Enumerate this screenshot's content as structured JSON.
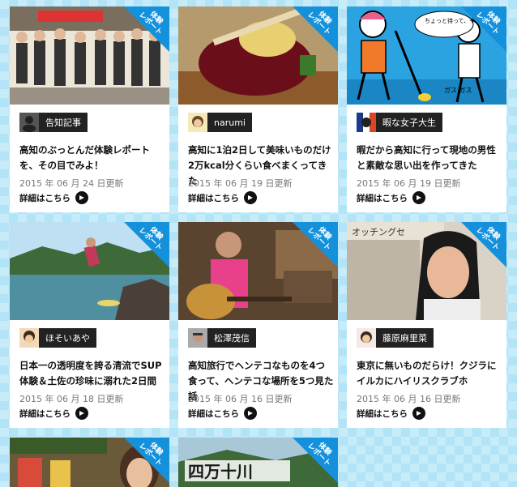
{
  "ribbon_text": "体験\nレポート",
  "more_label": "詳細はこちら",
  "cards": [
    {
      "author": "告知記事",
      "title": "高知のぶっとんだ体験レポートを、その目でみよ！",
      "date": "2015 年 06 月 24 日更新",
      "thumb_icon": "group-photo"
    },
    {
      "author": "narumi",
      "title": "高知に1泊2日して美味いものだけ2万kcal分くらい食べまくってきた",
      "date": "2015 年 06 月 19 日更新",
      "thumb_icon": "food-photo"
    },
    {
      "author": "暇な女子大生",
      "title": "暇だから高知に行って現地の男性と素敵な思い出を作ってきた",
      "date": "2015 年 06 月 19 日更新",
      "thumb_icon": "illustration",
      "speech": "ちょっと待って、やめっ ちょっ…",
      "caption": "ガス ガス"
    },
    {
      "author": "ほそいあや",
      "title": "日本一の透明度を誇る清流でSUP体験＆土佐の珍味に溺れた2日間",
      "date": "2015 年 06 月 18 日更新",
      "thumb_icon": "river-photo"
    },
    {
      "author": "松澤茂信",
      "title": "高知旅行でヘンテコなものを4つ食って、ヘンテコな場所を5つ見た話",
      "date": "2015 年 06 月 16 日更新",
      "thumb_icon": "guitar-photo"
    },
    {
      "author": "藤原麻里菜",
      "title": "東京に無いものだらけ！クジラにイルカにハイリスクラブホ",
      "date": "2015 年 06 月 16 日更新",
      "thumb_icon": "girl-photo",
      "sign": "オッチングセ"
    },
    {
      "thumb_icon": "shop-photo"
    },
    {
      "thumb_icon": "shimanto-photo",
      "sign": "四万十川"
    }
  ]
}
